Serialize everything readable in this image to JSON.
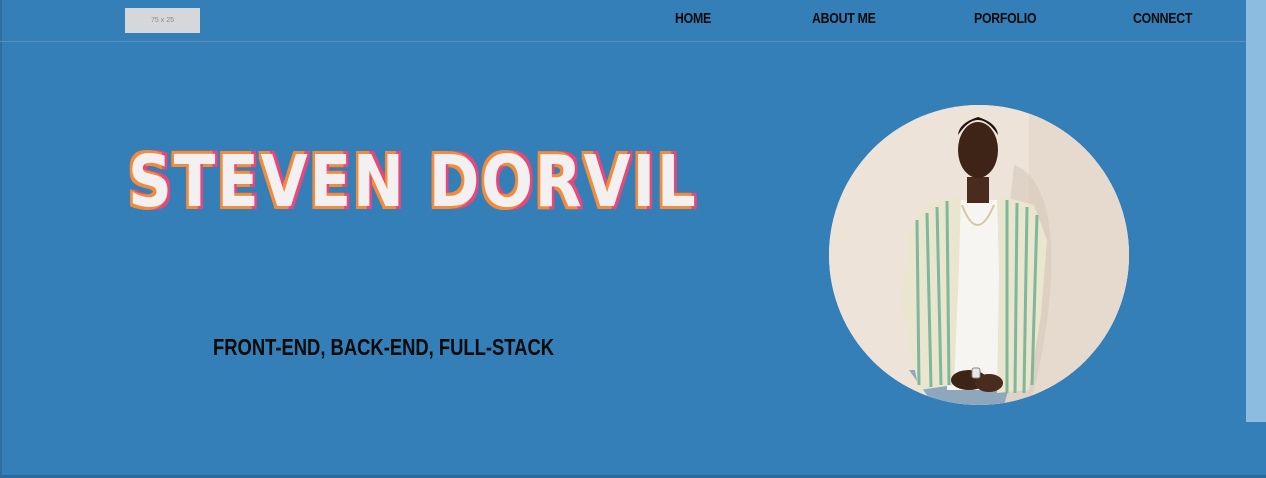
{
  "header": {
    "logo_placeholder": "75 x 25",
    "nav": {
      "home": "HOME",
      "about": "ABOUT ME",
      "portfolio": "PORFOLIO",
      "connect": "CONNECT"
    }
  },
  "hero": {
    "name": "STEVEN DORVIL",
    "subtitle": "FRONT-END, BACK-END, FULL-STACK",
    "portrait_alt": "Steven Dorvil portrait"
  },
  "colors": {
    "background": "#347FB8",
    "nav_text": "#0a0a0a",
    "title_fill": "#f3f0f1",
    "title_outline_orange": "#f28c3b",
    "title_outline_pink": "#e9467a",
    "scrollbar": "#8CBDE1"
  }
}
